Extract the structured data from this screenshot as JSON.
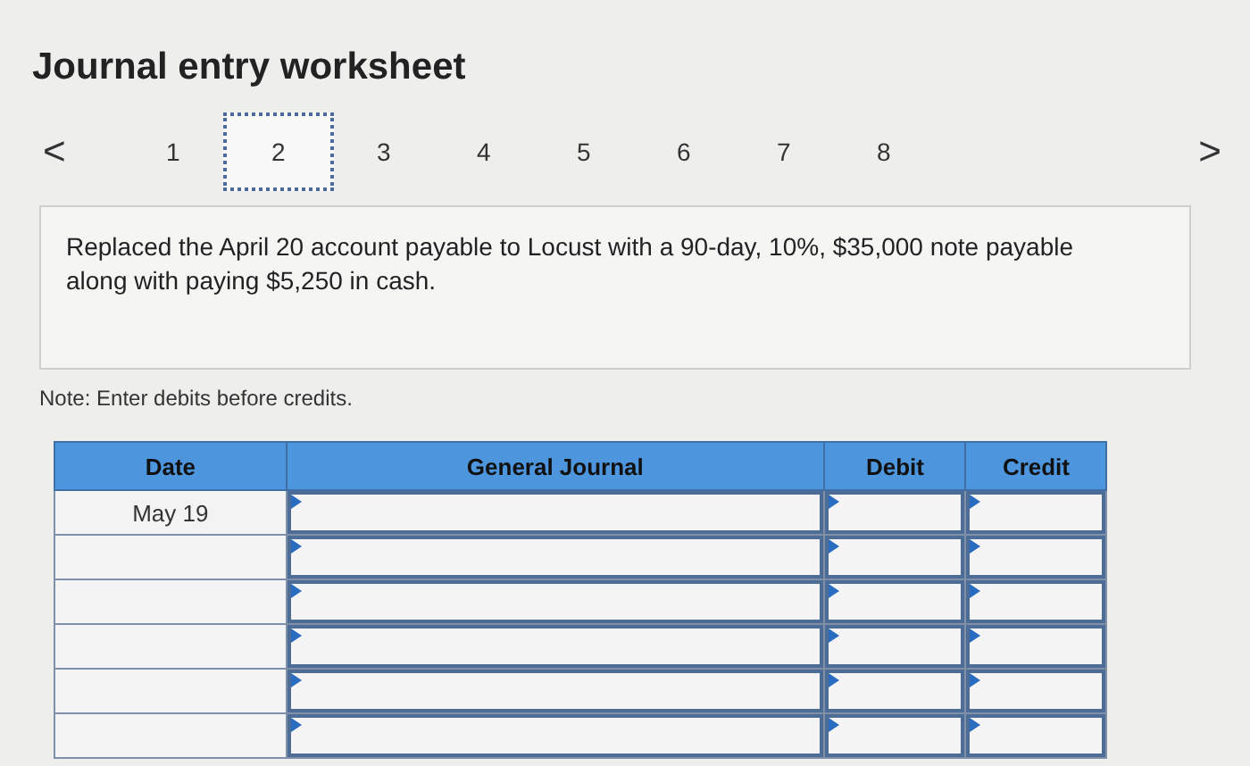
{
  "title": "Journal entry worksheet",
  "pager": {
    "prev": "<",
    "next": ">",
    "pages": [
      {
        "label": "1",
        "selected": false
      },
      {
        "label": "2",
        "selected": true
      },
      {
        "label": "3",
        "selected": false
      },
      {
        "label": "4",
        "selected": false
      },
      {
        "label": "5",
        "selected": false
      },
      {
        "label": "6",
        "selected": false
      },
      {
        "label": "7",
        "selected": false
      },
      {
        "label": "8",
        "selected": false
      }
    ]
  },
  "description": "Replaced the April 20 account payable to Locust with a 90-day, 10%, $35,000 note payable along with paying $5,250 in cash.",
  "note": "Note: Enter debits before credits.",
  "table": {
    "columns": [
      "Date",
      "General Journal",
      "Debit",
      "Credit"
    ],
    "rows": [
      {
        "date": "May 19"
      },
      {
        "date": ""
      },
      {
        "date": ""
      },
      {
        "date": ""
      },
      {
        "date": ""
      },
      {
        "date": ""
      }
    ]
  }
}
